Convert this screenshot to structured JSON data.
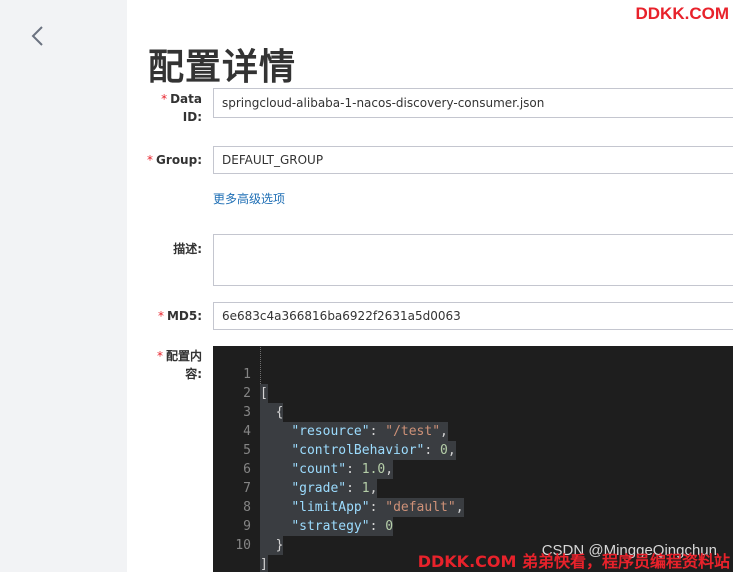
{
  "watermark": {
    "top": "DDKK.COM",
    "csdn": "CSDN @MinggeQingchun",
    "bottom": "DDKK.COM 弟弟快看，程序员编程资料站"
  },
  "page": {
    "title": "配置详情"
  },
  "form": {
    "data_id": {
      "label_line1": "Data",
      "label_line2": "ID:",
      "value": "springcloud-alibaba-1-nacos-discovery-consumer.json"
    },
    "group": {
      "label": "Group:",
      "value": "DEFAULT_GROUP"
    },
    "advanced_link": "更多高级选项",
    "description": {
      "label": "描述:",
      "value": ""
    },
    "md5": {
      "label": "MD5:",
      "value": "6e683c4a366816ba6922f2631a5d0063"
    },
    "content": {
      "label_line1": "配置内",
      "label_line2": "容:"
    },
    "required_mark": "*"
  },
  "editor": {
    "line_numbers": [
      "1",
      "2",
      "3",
      "4",
      "5",
      "6",
      "7",
      "8",
      "9",
      "10"
    ],
    "tokens": {
      "open_bracket": "[",
      "open_brace": "{",
      "k_resource": "\"resource\"",
      "v_resource": "\"/test\"",
      "k_control": "\"controlBehavior\"",
      "v_control": "0",
      "k_count": "\"count\"",
      "v_count": "1.0",
      "k_grade": "\"grade\"",
      "v_grade": "1",
      "k_limit": "\"limitApp\"",
      "v_limit": "\"default\"",
      "k_strategy": "\"strategy\"",
      "v_strategy": "0",
      "close_brace": "}",
      "close_bracket": "]",
      "colon": ": ",
      "comma": ","
    }
  },
  "colors": {
    "accent_red": "#e8222b",
    "link_blue": "#1f6fb5",
    "editor_bg": "#1e1e1e"
  },
  "icons": {
    "back": "chevron-left-icon"
  }
}
